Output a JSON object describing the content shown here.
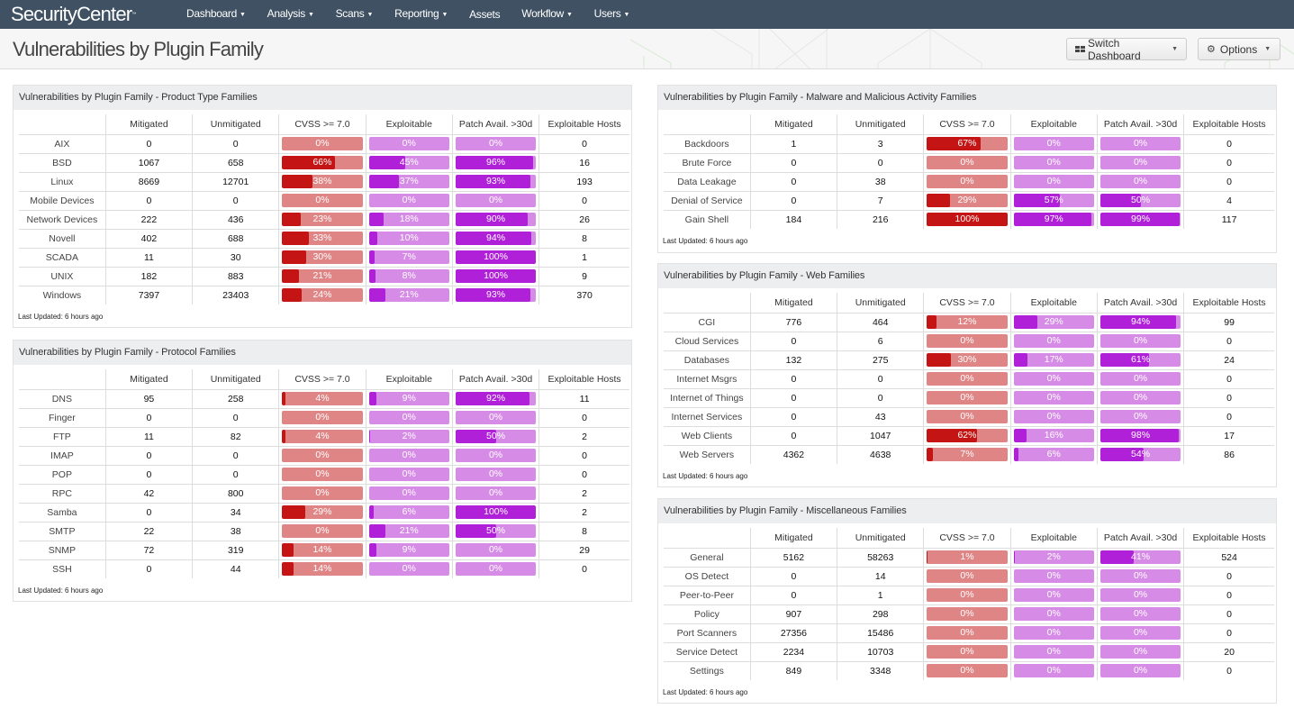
{
  "app": {
    "brand": "SecurityCenter",
    "nav": [
      {
        "label": "Dashboard",
        "dropdown": true
      },
      {
        "label": "Analysis",
        "dropdown": true
      },
      {
        "label": "Scans",
        "dropdown": true
      },
      {
        "label": "Reporting",
        "dropdown": true
      },
      {
        "label": "Assets",
        "dropdown": false
      },
      {
        "label": "Workflow",
        "dropdown": true
      },
      {
        "label": "Users",
        "dropdown": true
      }
    ]
  },
  "page": {
    "title": "Vulnerabilities by Plugin Family",
    "switch_dashboard_label": "Switch Dashboard",
    "options_label": "Options"
  },
  "colors": {
    "cvss_fill": "#c41414",
    "cvss_track": "#e08585",
    "purple_fill": "#b020d8",
    "purple_track": "#d68ce6",
    "nav_bg": "#3f5163"
  },
  "columns": [
    "",
    "Mitigated",
    "Unmitigated",
    "CVSS >= 7.0",
    "Exploitable",
    "Patch Avail. >30d",
    "Exploitable Hosts"
  ],
  "last_updated": "Last Updated: 6 hours ago",
  "panels": [
    {
      "id": "product",
      "title": "Vulnerabilities by Plugin Family - Product Type Families",
      "rows": [
        {
          "family": "AIX",
          "mitigated": "0",
          "unmitigated": "0",
          "cvss": 0,
          "exploitable": 0,
          "patch": 0,
          "hosts": "0"
        },
        {
          "family": "BSD",
          "mitigated": "1067",
          "unmitigated": "658",
          "cvss": 66,
          "exploitable": 45,
          "patch": 96,
          "hosts": "16"
        },
        {
          "family": "Linux",
          "mitigated": "8669",
          "unmitigated": "12701",
          "cvss": 38,
          "exploitable": 37,
          "patch": 93,
          "hosts": "193"
        },
        {
          "family": "Mobile Devices",
          "mitigated": "0",
          "unmitigated": "0",
          "cvss": 0,
          "exploitable": 0,
          "patch": 0,
          "hosts": "0"
        },
        {
          "family": "Network Devices",
          "mitigated": "222",
          "unmitigated": "436",
          "cvss": 23,
          "exploitable": 18,
          "patch": 90,
          "hosts": "26"
        },
        {
          "family": "Novell",
          "mitigated": "402",
          "unmitigated": "688",
          "cvss": 33,
          "exploitable": 10,
          "patch": 94,
          "hosts": "8"
        },
        {
          "family": "SCADA",
          "mitigated": "11",
          "unmitigated": "30",
          "cvss": 30,
          "exploitable": 7,
          "patch": 100,
          "hosts": "1"
        },
        {
          "family": "UNIX",
          "mitigated": "182",
          "unmitigated": "883",
          "cvss": 21,
          "exploitable": 8,
          "patch": 100,
          "hosts": "9"
        },
        {
          "family": "Windows",
          "mitigated": "7397",
          "unmitigated": "23403",
          "cvss": 24,
          "exploitable": 21,
          "patch": 93,
          "hosts": "370"
        }
      ]
    },
    {
      "id": "protocol",
      "title": "Vulnerabilities by Plugin Family - Protocol Families",
      "rows": [
        {
          "family": "DNS",
          "mitigated": "95",
          "unmitigated": "258",
          "cvss": 4,
          "exploitable": 9,
          "patch": 92,
          "hosts": "11"
        },
        {
          "family": "Finger",
          "mitigated": "0",
          "unmitigated": "0",
          "cvss": 0,
          "exploitable": 0,
          "patch": 0,
          "hosts": "0"
        },
        {
          "family": "FTP",
          "mitigated": "11",
          "unmitigated": "82",
          "cvss": 4,
          "exploitable": 2,
          "patch": 50,
          "hosts": "2"
        },
        {
          "family": "IMAP",
          "mitigated": "0",
          "unmitigated": "0",
          "cvss": 0,
          "exploitable": 0,
          "patch": 0,
          "hosts": "0"
        },
        {
          "family": "POP",
          "mitigated": "0",
          "unmitigated": "0",
          "cvss": 0,
          "exploitable": 0,
          "patch": 0,
          "hosts": "0"
        },
        {
          "family": "RPC",
          "mitigated": "42",
          "unmitigated": "800",
          "cvss": 0,
          "exploitable": 0,
          "patch": 0,
          "hosts": "2"
        },
        {
          "family": "Samba",
          "mitigated": "0",
          "unmitigated": "34",
          "cvss": 29,
          "exploitable": 6,
          "patch": 100,
          "hosts": "2"
        },
        {
          "family": "SMTP",
          "mitigated": "22",
          "unmitigated": "38",
          "cvss": 0,
          "exploitable": 21,
          "patch": 50,
          "hosts": "8"
        },
        {
          "family": "SNMP",
          "mitigated": "72",
          "unmitigated": "319",
          "cvss": 14,
          "exploitable": 9,
          "patch": 0,
          "hosts": "29"
        },
        {
          "family": "SSH",
          "mitigated": "0",
          "unmitigated": "44",
          "cvss": 14,
          "exploitable": 0,
          "patch": 0,
          "hosts": "0"
        }
      ]
    },
    {
      "id": "malware",
      "title": "Vulnerabilities by Plugin Family - Malware and Malicious Activity Families",
      "rows": [
        {
          "family": "Backdoors",
          "mitigated": "1",
          "unmitigated": "3",
          "cvss": 67,
          "exploitable": 0,
          "patch": 0,
          "hosts": "0"
        },
        {
          "family": "Brute Force",
          "mitigated": "0",
          "unmitigated": "0",
          "cvss": 0,
          "exploitable": 0,
          "patch": 0,
          "hosts": "0"
        },
        {
          "family": "Data Leakage",
          "mitigated": "0",
          "unmitigated": "38",
          "cvss": 0,
          "exploitable": 0,
          "patch": 0,
          "hosts": "0"
        },
        {
          "family": "Denial of Service",
          "mitigated": "0",
          "unmitigated": "7",
          "cvss": 29,
          "exploitable": 57,
          "patch": 50,
          "hosts": "4"
        },
        {
          "family": "Gain Shell",
          "mitigated": "184",
          "unmitigated": "216",
          "cvss": 100,
          "exploitable": 97,
          "patch": 99,
          "hosts": "117"
        }
      ]
    },
    {
      "id": "web",
      "title": "Vulnerabilities by Plugin Family - Web Families",
      "rows": [
        {
          "family": "CGI",
          "mitigated": "776",
          "unmitigated": "464",
          "cvss": 12,
          "exploitable": 29,
          "patch": 94,
          "hosts": "99"
        },
        {
          "family": "Cloud Services",
          "mitigated": "0",
          "unmitigated": "6",
          "cvss": 0,
          "exploitable": 0,
          "patch": 0,
          "hosts": "0"
        },
        {
          "family": "Databases",
          "mitigated": "132",
          "unmitigated": "275",
          "cvss": 30,
          "exploitable": 17,
          "patch": 61,
          "hosts": "24"
        },
        {
          "family": "Internet Msgrs",
          "mitigated": "0",
          "unmitigated": "0",
          "cvss": 0,
          "exploitable": 0,
          "patch": 0,
          "hosts": "0"
        },
        {
          "family": "Internet of Things",
          "mitigated": "0",
          "unmitigated": "0",
          "cvss": 0,
          "exploitable": 0,
          "patch": 0,
          "hosts": "0"
        },
        {
          "family": "Internet Services",
          "mitigated": "0",
          "unmitigated": "43",
          "cvss": 0,
          "exploitable": 0,
          "patch": 0,
          "hosts": "0"
        },
        {
          "family": "Web Clients",
          "mitigated": "0",
          "unmitigated": "1047",
          "cvss": 62,
          "exploitable": 16,
          "patch": 98,
          "hosts": "17"
        },
        {
          "family": "Web Servers",
          "mitigated": "4362",
          "unmitigated": "4638",
          "cvss": 7,
          "exploitable": 6,
          "patch": 54,
          "hosts": "86"
        }
      ]
    },
    {
      "id": "misc",
      "title": "Vulnerabilities by Plugin Family - Miscellaneous Families",
      "rows": [
        {
          "family": "General",
          "mitigated": "5162",
          "unmitigated": "58263",
          "cvss": 1,
          "exploitable": 2,
          "patch": 41,
          "hosts": "524"
        },
        {
          "family": "OS Detect",
          "mitigated": "0",
          "unmitigated": "14",
          "cvss": 0,
          "exploitable": 0,
          "patch": 0,
          "hosts": "0"
        },
        {
          "family": "Peer-to-Peer",
          "mitigated": "0",
          "unmitigated": "1",
          "cvss": 0,
          "exploitable": 0,
          "patch": 0,
          "hosts": "0"
        },
        {
          "family": "Policy",
          "mitigated": "907",
          "unmitigated": "298",
          "cvss": 0,
          "exploitable": 0,
          "patch": 0,
          "hosts": "0"
        },
        {
          "family": "Port Scanners",
          "mitigated": "27356",
          "unmitigated": "15486",
          "cvss": 0,
          "exploitable": 0,
          "patch": 0,
          "hosts": "0"
        },
        {
          "family": "Service Detect",
          "mitigated": "2234",
          "unmitigated": "10703",
          "cvss": 0,
          "exploitable": 0,
          "patch": 0,
          "hosts": "20"
        },
        {
          "family": "Settings",
          "mitigated": "849",
          "unmitigated": "3348",
          "cvss": 0,
          "exploitable": 0,
          "patch": 0,
          "hosts": "0"
        }
      ]
    }
  ]
}
